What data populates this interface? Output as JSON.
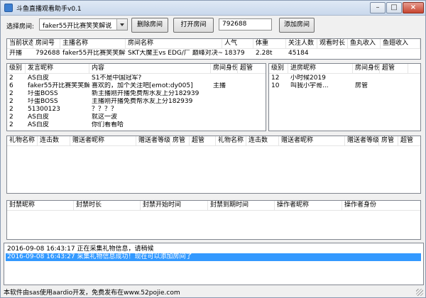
{
  "window": {
    "title": "斗鱼直播观看助手v0.1",
    "min_glyph": "–",
    "max_glyph": "□",
    "close_glyph": "×"
  },
  "toolbar": {
    "select_room_label": "选择房间:",
    "room_select_value": "faker55开比赛笑笑解说",
    "delete_room_button": "删除房间",
    "open_room_button": "打开房间",
    "room_id_input_value": "792688",
    "add_room_button": "添加房间"
  },
  "room_info": {
    "headers": [
      "当前状态",
      "房间号",
      "主播名称",
      "房间名称",
      "人气",
      "体重",
      "关注人数",
      "观看时长",
      "鱼丸收入",
      "鱼翅收入"
    ],
    "row": [
      "开播",
      "792688",
      "faker55开比赛笑笑解说",
      "SKT大魔王vs EDG/厂 巅峰对决~",
      "18379",
      "2.28t",
      "45184",
      "",
      "",
      ""
    ]
  },
  "chat": {
    "headers": [
      "级别",
      "发言昵称",
      "内容",
      "房间身份",
      "超管"
    ],
    "rows": [
      [
        "2",
        "AS白皮",
        "S1不是中国冠军?",
        "",
        ""
      ],
      [
        "6",
        "faker55开比赛笑笑解说",
        "喜欢的，加个关注吧[emot:dy005]",
        "主播",
        ""
      ],
      [
        "2",
        "圩蛋BOSS",
        "新主播刚开播免费帮水友上分182939",
        "",
        ""
      ],
      [
        "2",
        "圩蛋BOSS",
        "主播刚开播免费帮水友上分182939",
        "",
        ""
      ],
      [
        "2",
        "51300123",
        "？？？？",
        "",
        ""
      ],
      [
        "2",
        "AS白皮",
        "就这一波",
        "",
        ""
      ],
      [
        "2",
        "AS白皮",
        "你们看看哈",
        "",
        ""
      ]
    ]
  },
  "enter": {
    "headers": [
      "级别",
      "进房昵称",
      "房间身份",
      "超管"
    ],
    "rows": [
      [
        "12",
        "小时候2019",
        "",
        ""
      ],
      [
        "10",
        "叫我小宇哥...",
        "房管",
        ""
      ]
    ]
  },
  "gifts": {
    "headers": [
      "礼物名称",
      "连击数",
      "赠送者昵称",
      "赠送者等级",
      "房管",
      "超管",
      "礼物名称",
      "连击数",
      "赠送者昵称",
      "赠送者等级",
      "房管",
      "超管"
    ]
  },
  "bans": {
    "headers": [
      "封禁昵称",
      "封禁时长",
      "封禁开始时间",
      "封禁到期时间",
      "操作者昵称",
      "操作者身份"
    ]
  },
  "log": {
    "lines": [
      "2016-09-08 16:43:17 正在采集礼物信息，请稍候",
      "2016-09-08 16:43:27 采集礼物信息成功！现在可以添加房间了"
    ]
  },
  "status": {
    "text": "本软件由sas使用aardio开发，免费发布在www.52pojie.com"
  },
  "colors": {
    "selection": "#3399ff",
    "panel_border": "#828790"
  }
}
